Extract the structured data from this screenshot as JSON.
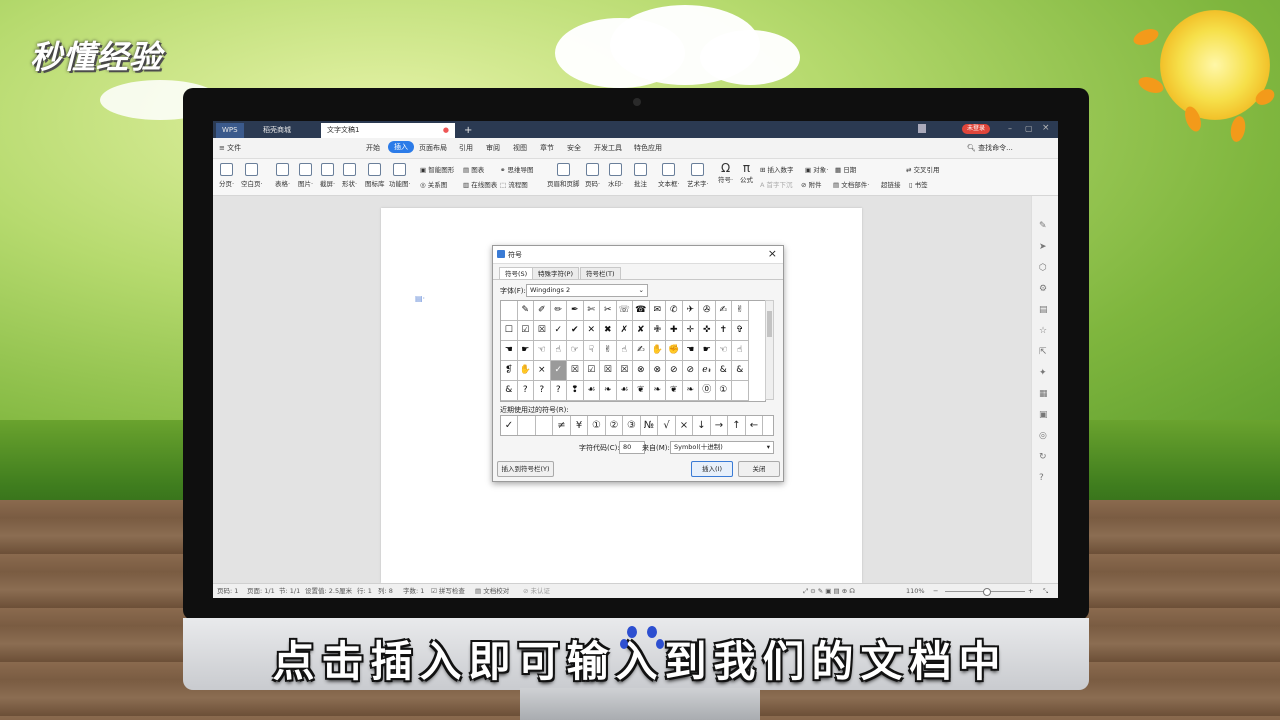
{
  "watermark": {
    "brand": "秒懂经验"
  },
  "caption": "点击插入即可输入到我们的文档中",
  "colors": {
    "title_bar": "#2b3a52",
    "accent_blue": "#2b7be8",
    "login_red": "#e0463b"
  },
  "app": {
    "tabs": [
      {
        "label": "WPS"
      },
      {
        "label": "稻壳商城"
      },
      {
        "label": "文字文稿1"
      }
    ],
    "add_tab": "+",
    "login": "未登录",
    "menus": [
      "文件",
      "开始",
      "插入",
      "页面布局",
      "引用",
      "审阅",
      "视图",
      "章节",
      "安全",
      "开发工具",
      "特色应用"
    ],
    "active_menu": "插入",
    "search": "查找命令...",
    "ribbon": [
      {
        "label": "分页·",
        "icon": "page-break-icon"
      },
      {
        "label": "空白页·",
        "icon": "blank-page-icon"
      },
      {
        "label": "表格·",
        "icon": "table-icon"
      },
      {
        "label": "图片·",
        "icon": "picture-icon"
      },
      {
        "label": "截屏·",
        "icon": "screenshot-icon"
      },
      {
        "label": "形状·",
        "icon": "shape-icon"
      },
      {
        "label": "图标库",
        "icon": "icon-library-icon"
      },
      {
        "label": "功能图·",
        "icon": "function-chart-icon"
      }
    ],
    "ribbon_small": [
      {
        "label": "智能图形"
      },
      {
        "label": "图表"
      },
      {
        "label": "思维导图"
      },
      {
        "label": "关系图"
      },
      {
        "label": "在线图表"
      },
      {
        "label": "流程图"
      }
    ],
    "ribbon2": [
      {
        "label": "页眉和页脚"
      },
      {
        "label": "页码·"
      },
      {
        "label": "水印·"
      },
      {
        "label": "批注"
      },
      {
        "label": "文本框·"
      },
      {
        "label": "艺术字·"
      },
      {
        "label": "符号·"
      },
      {
        "label": "公式"
      }
    ],
    "ribbon_small2": [
      {
        "label": "插入数字"
      },
      {
        "label": "对象·"
      },
      {
        "label": "日期"
      },
      {
        "label": "首字下沉"
      },
      {
        "label": "附件"
      },
      {
        "label": "文档部件·"
      },
      {
        "label": "交叉引用"
      },
      {
        "label": "超链接"
      },
      {
        "label": "书签"
      }
    ],
    "status": {
      "page": "页码: 1",
      "pages": "页面: 1/1",
      "section": "节: 1/1",
      "setting": "设置值: 2.5厘米",
      "row": "行: 1",
      "col": "列: 8",
      "words": "字数: 1",
      "spell": "拼写检查",
      "proof": "文档校对",
      "cert": "未认证",
      "zoom": "110%"
    }
  },
  "dialog": {
    "title": "符号",
    "close": "×",
    "tabs": [
      "符号(S)",
      "特殊字符(P)",
      "符号栏(T)"
    ],
    "font_label": "字体(F):",
    "font_value": "Wingdings 2",
    "grid": [
      [
        "",
        "✎",
        "✐",
        "✏",
        "✒",
        "✄",
        "✂",
        "☏",
        "☎",
        "✉",
        "✆",
        "✈",
        "✇",
        "✍",
        "✌"
      ],
      [
        "☐",
        "☑",
        "☒",
        "✓",
        "✔",
        "✕",
        "✖",
        "✗",
        "✘",
        "✙",
        "✚",
        "✛",
        "✜",
        "✝",
        "✞"
      ],
      [
        "☚",
        "☛",
        "☜",
        "☝",
        "☞",
        "☟",
        "✌",
        "☝",
        "✍",
        "✋",
        "✊",
        "☚",
        "☛",
        "☜",
        "☝"
      ],
      [
        "❡",
        "✋",
        "×",
        "✓",
        "☒",
        "☑",
        "☒",
        "☒",
        "⊗",
        "⊗",
        "⊘",
        "⊘",
        "ℯ𝓇",
        "&",
        "&"
      ],
      [
        "&",
        "?",
        "?",
        "?",
        "❢",
        "☙",
        "❧",
        "☙",
        "❦",
        "❧",
        "❦",
        "❧",
        "⓪",
        "①",
        ""
      ]
    ],
    "selected": {
      "row": 3,
      "col": 3
    },
    "recent_label": "近期使用过的符号(R):",
    "recent": [
      "✓",
      "",
      "",
      "≠",
      "¥",
      "①",
      "②",
      "③",
      "№",
      "√",
      "×",
      "↓",
      "→",
      "↑",
      "←"
    ],
    "code_label": "字符代码(C):",
    "code_value": "80",
    "from_label": "来自(M):",
    "from_value": "Symbol(十进制)",
    "btn_insert_to_bar": "插入到符号栏(Y)",
    "btn_insert": "插入(I)",
    "btn_close": "关闭"
  }
}
